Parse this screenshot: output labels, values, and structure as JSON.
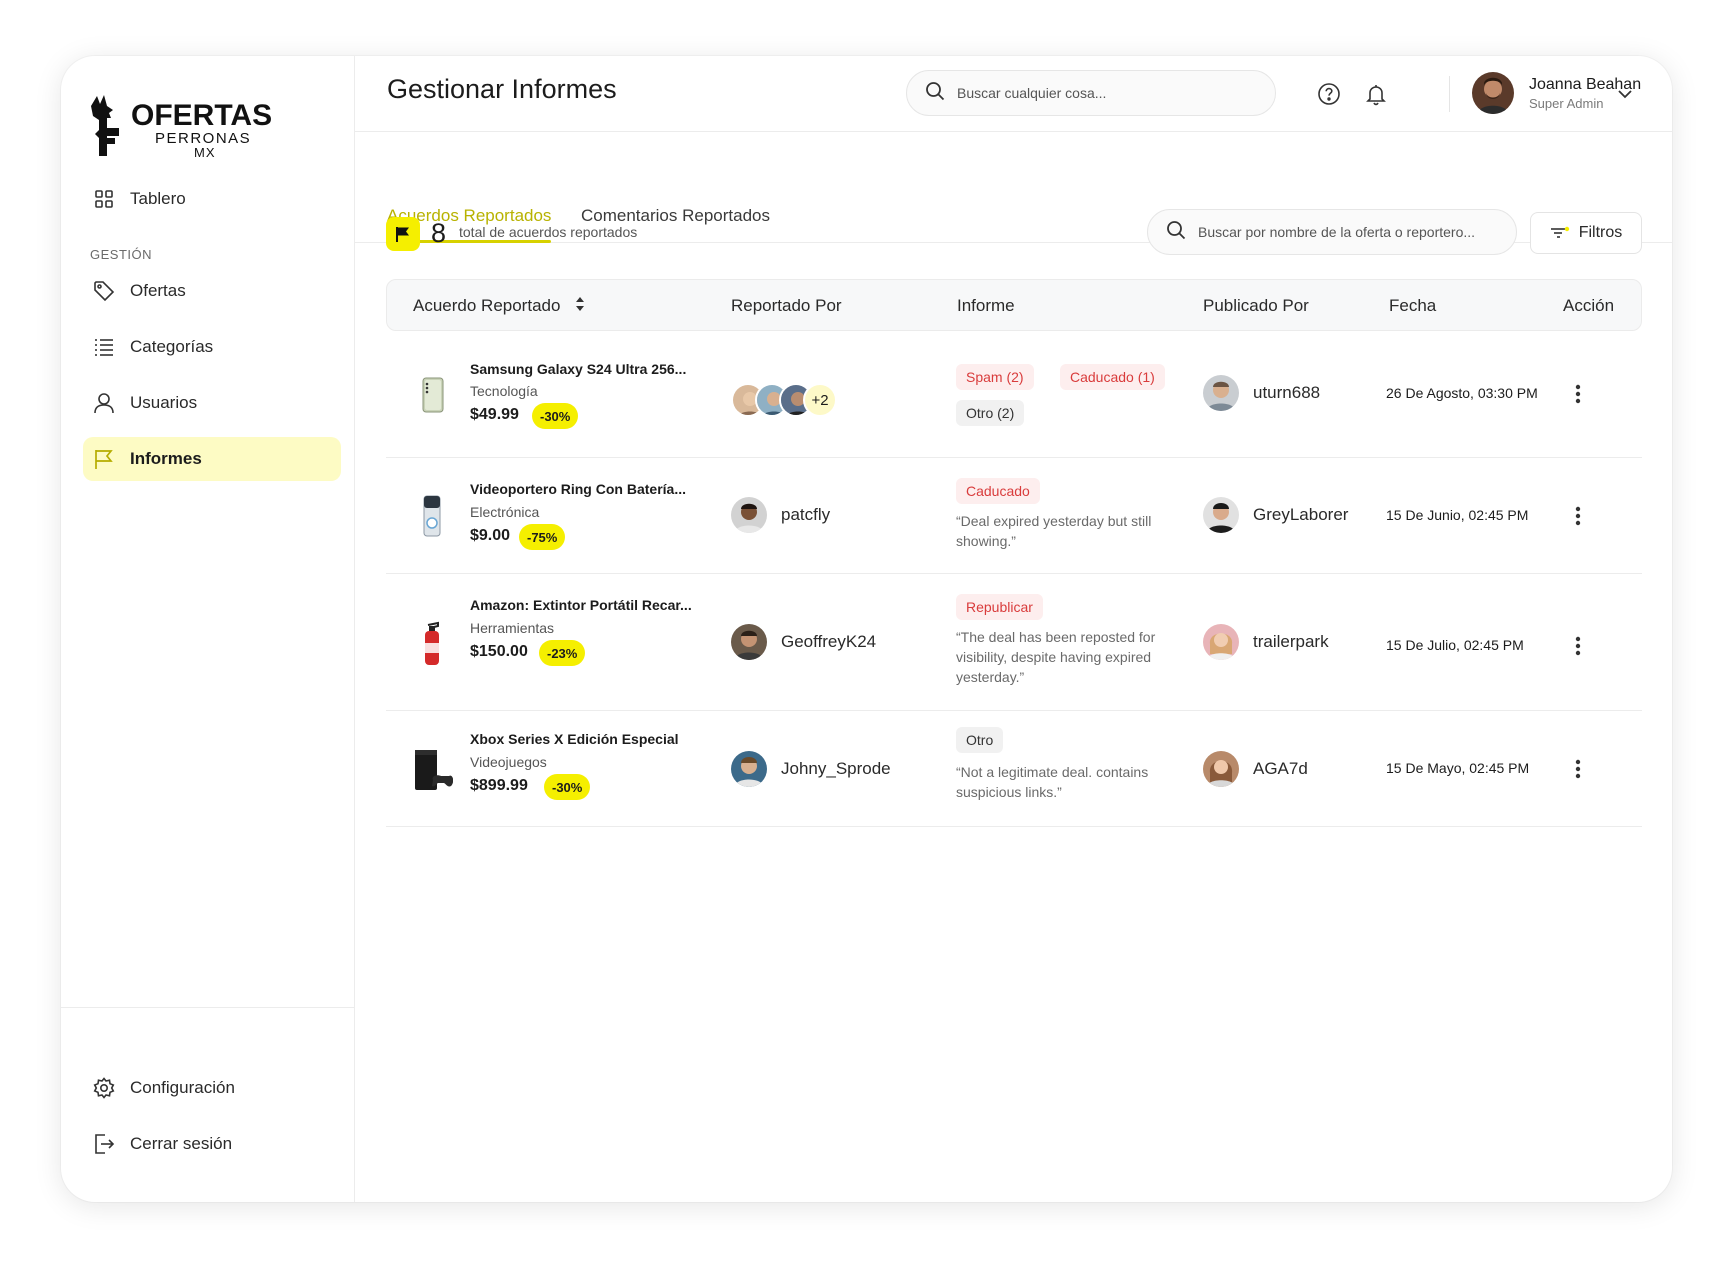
{
  "brand": {
    "logo_main": "OFERTAS",
    "logo_sub": "PERRONAS",
    "logo_country": "MX",
    "accent": "#f5ef00",
    "accent_dark": "#d7d100"
  },
  "sidebar": {
    "dashboard": {
      "label": "Tablero",
      "icon": "grid-icon"
    },
    "section_label": "GESTIÓN",
    "items": [
      {
        "label": "Ofertas",
        "icon": "tag-icon"
      },
      {
        "label": "Categorías",
        "icon": "list-icon"
      },
      {
        "label": "Usuarios",
        "icon": "user-icon"
      },
      {
        "label": "Informes",
        "icon": "flag-icon",
        "active": true
      }
    ],
    "bottom": [
      {
        "label": "Configuración",
        "icon": "gear-icon"
      },
      {
        "label": "Cerrar sesión",
        "icon": "logout-icon"
      }
    ]
  },
  "header": {
    "title": "Gestionar Informes",
    "search_placeholder": "Buscar cualquier cosa...",
    "user": {
      "name": "Joanna Beahan",
      "role": "Super Admin"
    }
  },
  "tabs": [
    {
      "label": "Acuerdos Reportados",
      "active": true
    },
    {
      "label": "Comentarios Reportados",
      "active": false
    }
  ],
  "summary": {
    "total": "8",
    "total_label": "total de acuerdos reportados",
    "search_placeholder": "Buscar por nombre de la oferta o reportero...",
    "filter_label": "Filtros"
  },
  "table": {
    "columns": [
      "Acuerdo Reportado",
      "Reportado Por",
      "Informe",
      "Publicado Por",
      "Fecha",
      "Acción"
    ],
    "rows": [
      {
        "product": {
          "name": "Samsung Galaxy S24 Ultra 256...",
          "category": "Tecnología",
          "price": "$49.99",
          "discount": "-30%",
          "image": "phone-icon"
        },
        "reported_by": {
          "avatars": 3,
          "more": "+2"
        },
        "report": {
          "tags": [
            {
              "text": "Spam (2)",
              "tone": "red"
            },
            {
              "text": "Caducado (1)",
              "tone": "red"
            },
            {
              "text": "Otro (2)",
              "tone": "grey"
            }
          ],
          "quote": ""
        },
        "published_by": "uturn688",
        "date": "26 De Agosto, 03:30 PM"
      },
      {
        "product": {
          "name": "Videoportero Ring Con Batería...",
          "category": "Electrónica",
          "price": "$9.00",
          "discount": "-75%",
          "image": "doorbell-icon"
        },
        "reported_by": {
          "name": "patcfly"
        },
        "report": {
          "tags": [
            {
              "text": "Caducado",
              "tone": "red"
            }
          ],
          "quote": "“Deal expired yesterday but still showing.”"
        },
        "published_by": "GreyLaborer",
        "date": "15 De Junio, 02:45 PM"
      },
      {
        "product": {
          "name": "Amazon: Extintor Portátil Recar...",
          "category": "Herramientas",
          "price": "$150.00",
          "discount": "-23%",
          "image": "extinguisher-icon"
        },
        "reported_by": {
          "name": "GeoffreyK24"
        },
        "report": {
          "tags": [
            {
              "text": "Republicar",
              "tone": "red"
            }
          ],
          "quote": "“The deal has been reposted for visibility, despite having expired yesterday.”"
        },
        "published_by": "trailerpark",
        "date": "15 De Julio, 02:45 PM"
      },
      {
        "product": {
          "name": "Xbox Series X Edición Especial",
          "category": "Videojuegos",
          "price": "$899.99",
          "discount": "-30%",
          "image": "console-icon"
        },
        "reported_by": {
          "name": "Johny_Sprode"
        },
        "report": {
          "tags": [
            {
              "text": "Otro",
              "tone": "grey"
            }
          ],
          "quote": "“Not a legitimate deal. contains suspicious links.”"
        },
        "published_by": "AGA7d",
        "date": "15 De Mayo, 02:45 PM"
      }
    ]
  }
}
